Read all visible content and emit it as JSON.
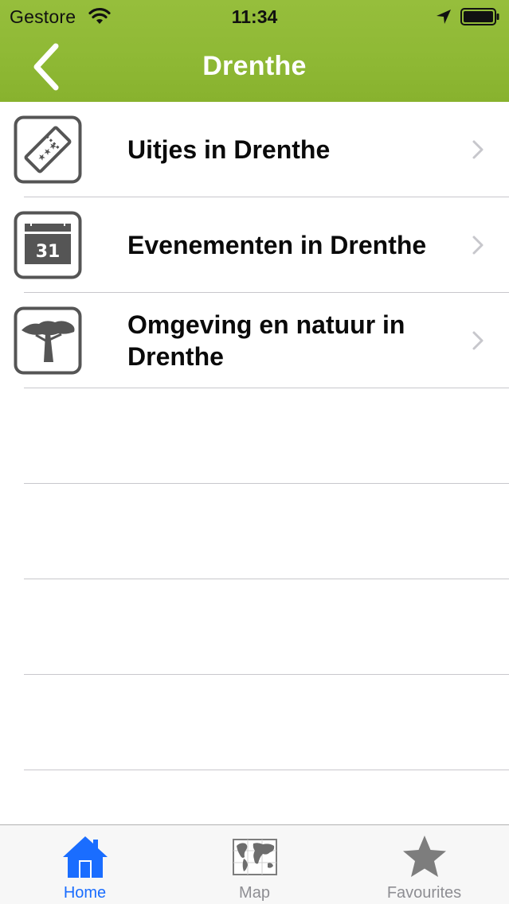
{
  "status_bar": {
    "carrier": "Gestore",
    "time": "11:34"
  },
  "nav": {
    "title": "Drenthe",
    "back_icon": "chevron-left-icon"
  },
  "rows": [
    {
      "label": "Uitjes in Drenthe",
      "icon": "ticket-icon"
    },
    {
      "label": "Evenementen in Drenthe",
      "icon": "calendar-icon",
      "icon_text": "31"
    },
    {
      "label": "Omgeving en natuur in Drenthe",
      "icon": "tree-icon"
    }
  ],
  "tabs": [
    {
      "label": "Home",
      "icon": "home-icon",
      "active": true
    },
    {
      "label": "Map",
      "icon": "map-icon",
      "active": false
    },
    {
      "label": "Favourites",
      "icon": "star-icon",
      "active": false
    }
  ],
  "colors": {
    "nav_green": "#8fb935",
    "active_tab": "#1a6dff",
    "inactive_tab": "#8e8e93",
    "icon_gray": "#555555"
  }
}
